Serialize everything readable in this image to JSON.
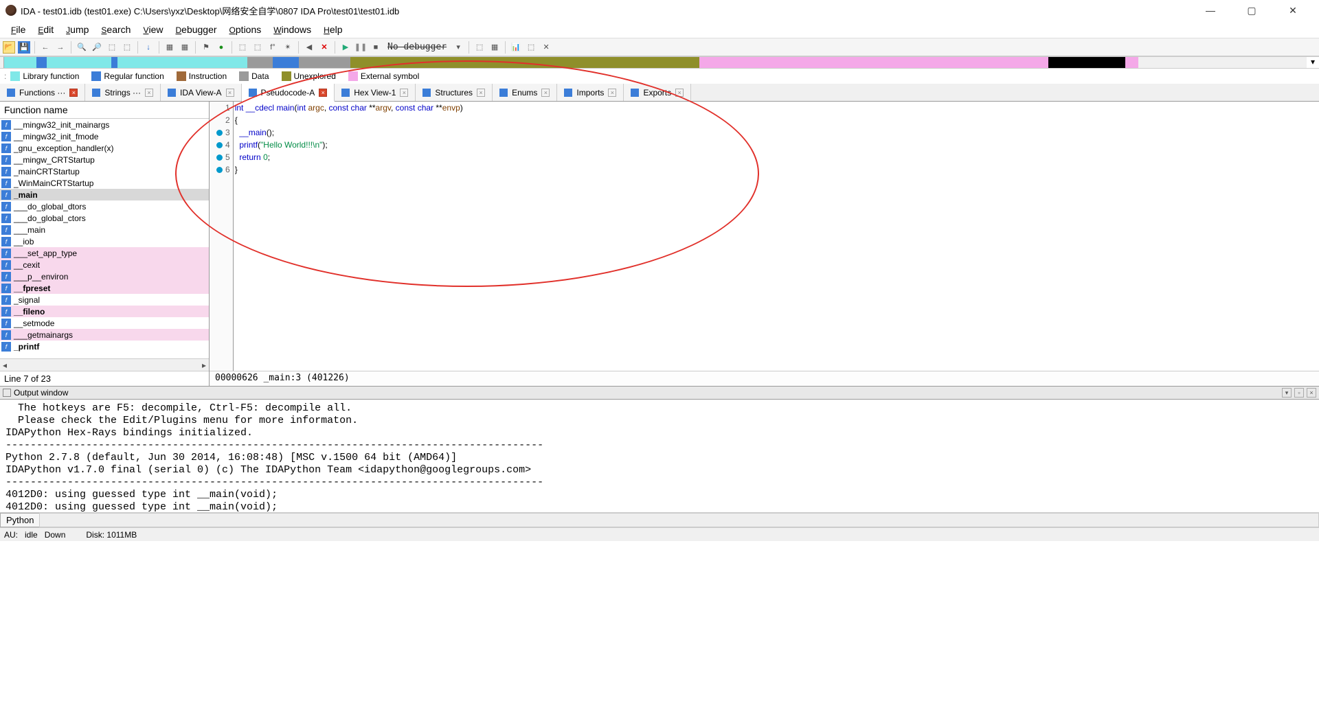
{
  "title": "IDA - test01.idb (test01.exe) C:\\Users\\yxz\\Desktop\\网络安全自学\\0807 IDA Pro\\test01\\test01.idb",
  "menus": [
    "File",
    "Edit",
    "Jump",
    "Search",
    "View",
    "Debugger",
    "Options",
    "Windows",
    "Help"
  ],
  "no_debugger": "No debugger",
  "legend": [
    {
      "c": "#80e8e8",
      "t": "Library function"
    },
    {
      "c": "#3b7dd8",
      "t": "Regular function"
    },
    {
      "c": "#a06a3a",
      "t": "Instruction"
    },
    {
      "c": "#9a9a9a",
      "t": "Data"
    },
    {
      "c": "#8f8f2a",
      "t": "Unexplored"
    },
    {
      "c": "#f4a8e8",
      "t": "External symbol"
    }
  ],
  "nav_segments": [
    {
      "c": "#80e8e8",
      "w": 2.5
    },
    {
      "c": "#3b7dd8",
      "w": 0.8
    },
    {
      "c": "#80e8e8",
      "w": 5
    },
    {
      "c": "#3b7dd8",
      "w": 0.5
    },
    {
      "c": "#80e8e8",
      "w": 10
    },
    {
      "c": "#9a9a9a",
      "w": 2
    },
    {
      "c": "#3b7dd8",
      "w": 2
    },
    {
      "c": "#9a9a9a",
      "w": 4
    },
    {
      "c": "#8f8f2a",
      "w": 27
    },
    {
      "c": "#f4a8e8",
      "w": 27
    },
    {
      "c": "#000",
      "w": 6
    },
    {
      "c": "#f4a8e8",
      "w": 1
    }
  ],
  "tabs": [
    {
      "label": "Functions",
      "dots": "···",
      "close": "red"
    },
    {
      "label": "Strings",
      "dots": "···",
      "close": "gray"
    },
    {
      "label": "IDA View-A",
      "close": "gray"
    },
    {
      "label": "Pseudocode-A",
      "close": "red",
      "active": true
    },
    {
      "label": "Hex View-1",
      "close": "gray"
    },
    {
      "label": "Structures",
      "close": "gray"
    },
    {
      "label": "Enums",
      "close": "gray"
    },
    {
      "label": "Imports",
      "close": "gray"
    },
    {
      "label": "Exports",
      "close": "gray"
    }
  ],
  "func_header": "Function name",
  "functions": [
    {
      "n": "__mingw32_init_mainargs"
    },
    {
      "n": "__mingw32_init_fmode"
    },
    {
      "n": "_gnu_exception_handler(x)"
    },
    {
      "n": "__mingw_CRTStartup"
    },
    {
      "n": "_mainCRTStartup"
    },
    {
      "n": "_WinMainCRTStartup"
    },
    {
      "n": "_main",
      "sel": true,
      "bold": true
    },
    {
      "n": "___do_global_dtors"
    },
    {
      "n": "___do_global_ctors"
    },
    {
      "n": "___main"
    },
    {
      "n": "__iob"
    },
    {
      "n": "___set_app_type",
      "pink": true
    },
    {
      "n": "__cexit",
      "pink": true
    },
    {
      "n": "___p__environ",
      "pink": true
    },
    {
      "n": "__fpreset",
      "pink": true,
      "bold": true
    },
    {
      "n": "_signal"
    },
    {
      "n": "__fileno",
      "pink": true,
      "bold": true
    },
    {
      "n": "__setmode"
    },
    {
      "n": "___getmainargs",
      "pink": true
    },
    {
      "n": "_printf",
      "bold": true
    }
  ],
  "func_status": "Line 7 of 23",
  "code_lines": [
    {
      "n": 1,
      "dot": false,
      "html": "<span class='ty'>int</span> <span class='kw'>__cdecl</span> <span class='fn'>main</span>(<span class='ty'>int</span> <span class='ptr'>argc</span>, <span class='ty'>const char</span> **<span class='ptr'>argv</span>, <span class='ty'>const char</span> **<span class='ptr'>envp</span>)"
    },
    {
      "n": 2,
      "dot": false,
      "html": "{"
    },
    {
      "n": 3,
      "dot": true,
      "html": "  <span class='fn'>__main</span>();"
    },
    {
      "n": 4,
      "dot": true,
      "html": "  <span class='fn'>printf</span>(<span class='str'>\"Hello World!!!\\n\"</span>);"
    },
    {
      "n": 5,
      "dot": true,
      "html": "  <span class='kw'>return</span> <span class='num'>0</span>;"
    },
    {
      "n": 6,
      "dot": true,
      "html": "}"
    }
  ],
  "code_status": "00000626 _main:3 (401226)",
  "output_title": "Output window",
  "output_text": "  The hotkeys are F5: decompile, Ctrl-F5: decompile all.\n  Please check the Edit/Plugins menu for more informaton.\nIDAPython Hex-Rays bindings initialized.\n---------------------------------------------------------------------------------------\nPython 2.7.8 (default, Jun 30 2014, 16:08:48) [MSC v.1500 64 bit (AMD64)]\nIDAPython v1.7.0 final (serial 0) (c) The IDAPython Team <idapython@googlegroups.com>\n---------------------------------------------------------------------------------------\n4012D0: using guessed type int __main(void);\n4012D0: using guessed type int __main(void);",
  "python_tab": "Python",
  "status": {
    "au": "AU:",
    "idle": "idle",
    "down": "Down",
    "disk": "Disk: 1011MB"
  }
}
